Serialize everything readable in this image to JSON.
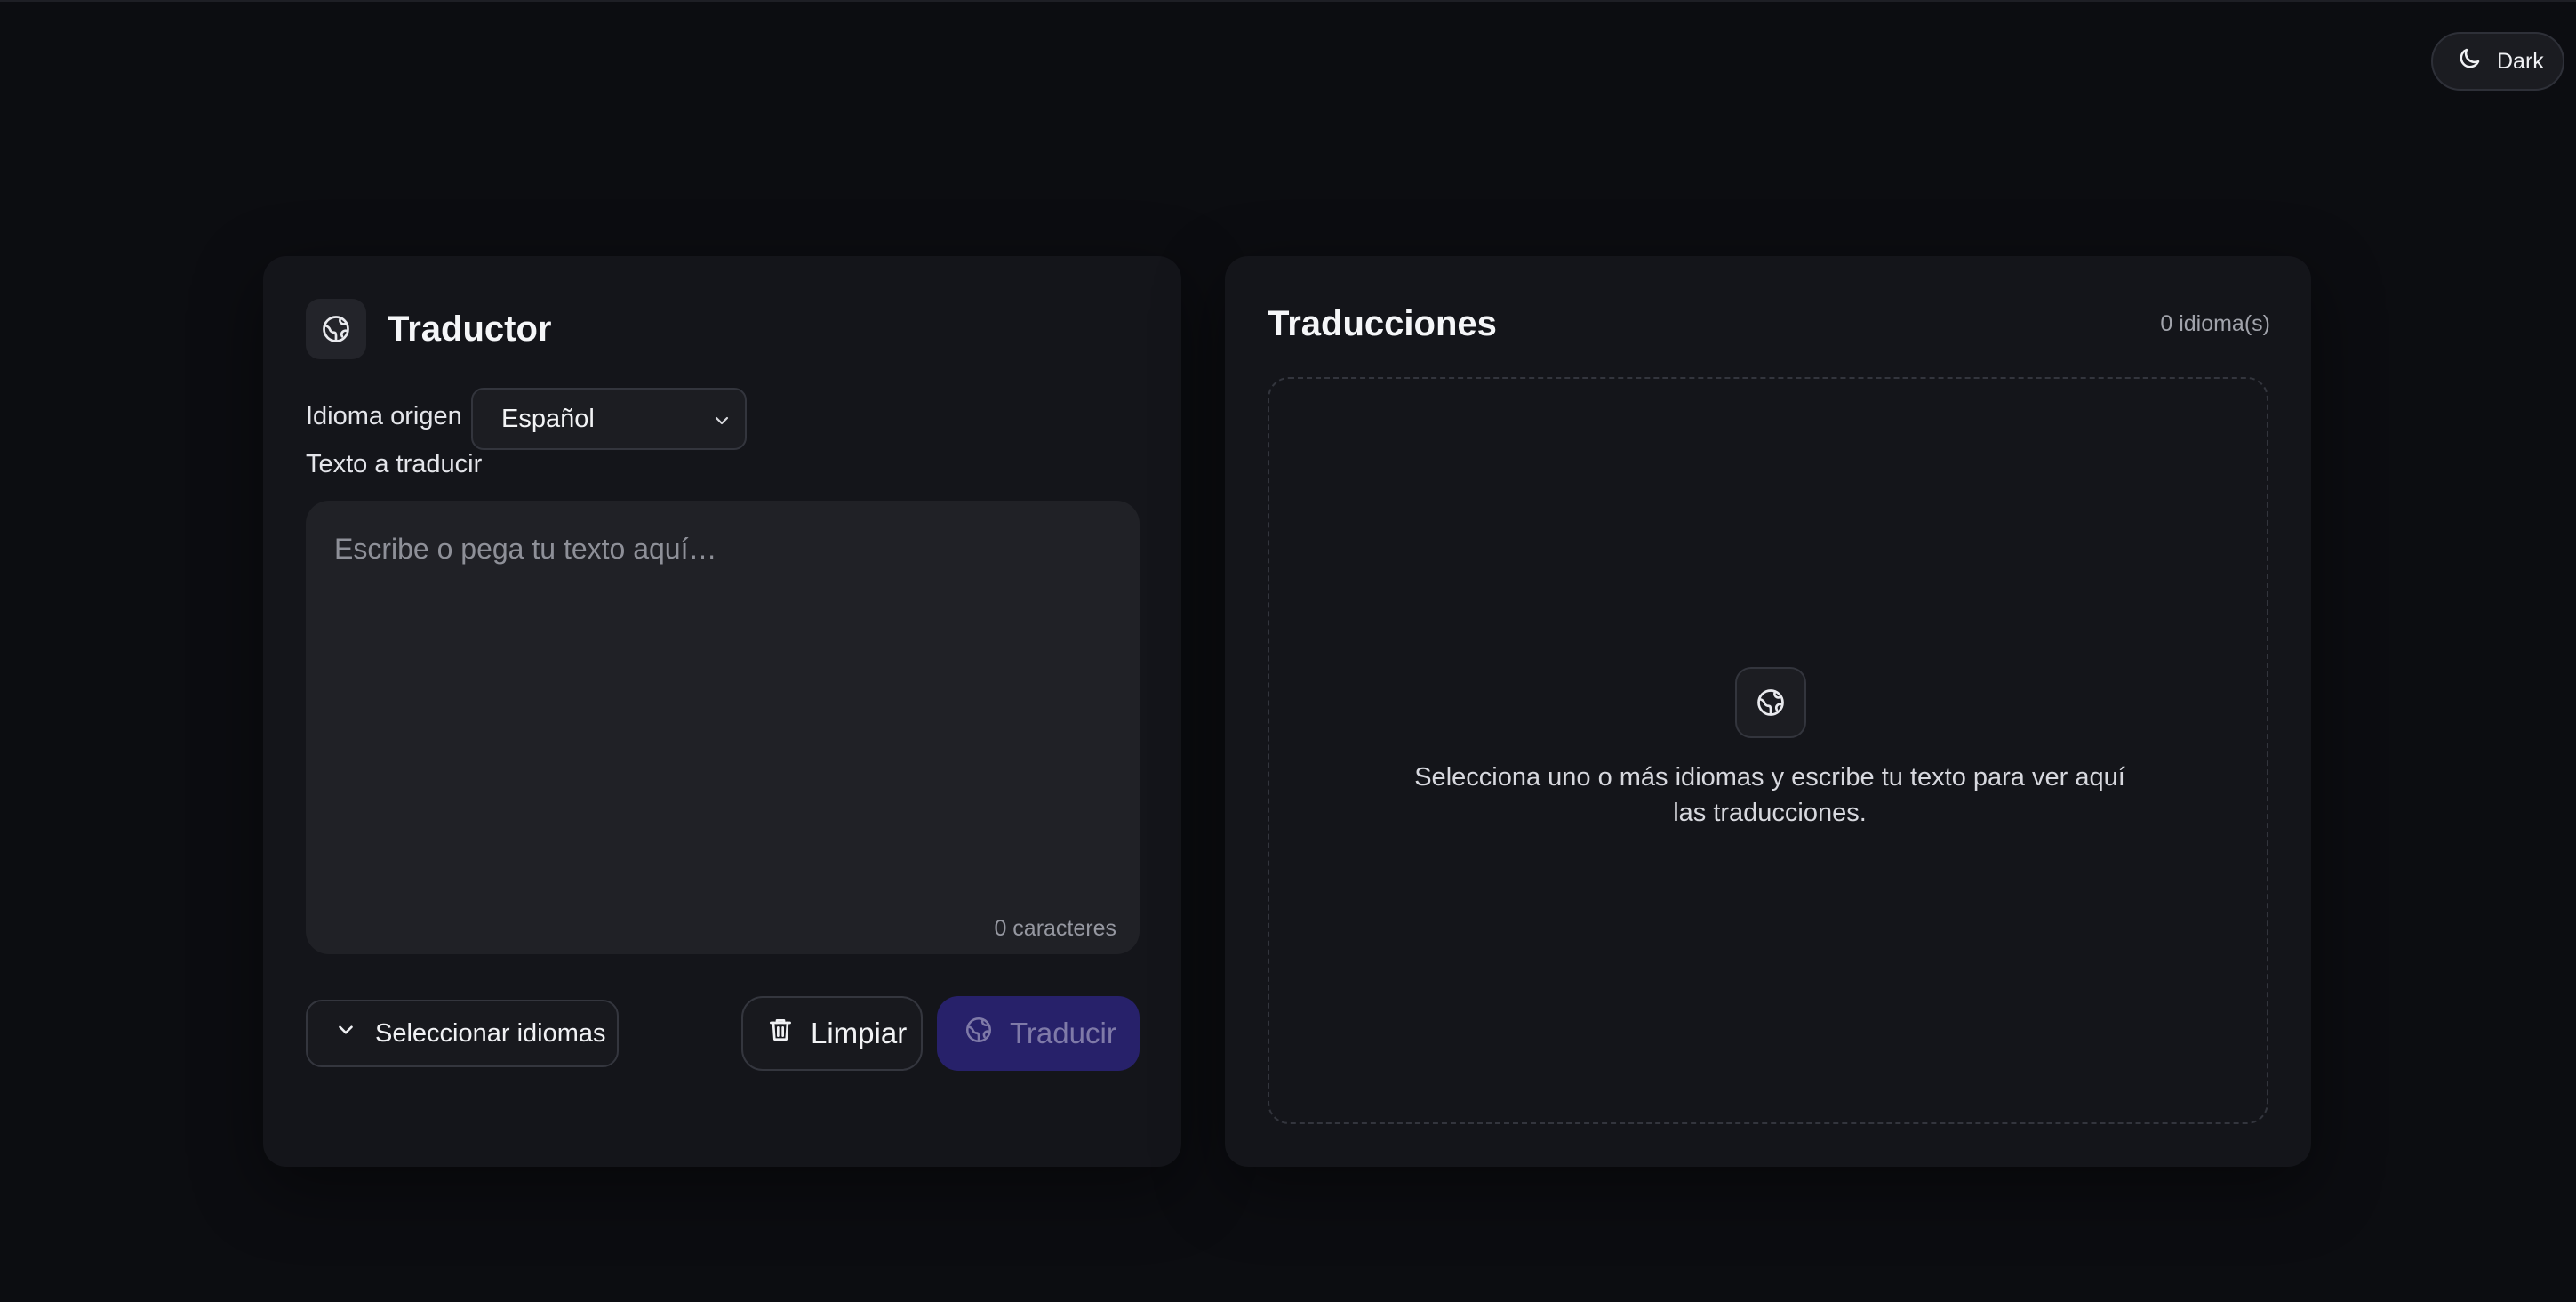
{
  "theme_toggle": {
    "label": "Dark",
    "icon": "moon-icon"
  },
  "translator": {
    "title": "Traductor",
    "icon": "globe-icon",
    "source_label": "Idioma origen",
    "source_value": "Español",
    "text_label": "Texto a traducir",
    "text_placeholder": "Escribe o pega tu texto aquí…",
    "char_count": "0 caracteres",
    "select_languages_label": "Seleccionar idiomas",
    "clear_label": "Limpiar",
    "translate_label": "Traducir"
  },
  "translations": {
    "title": "Traducciones",
    "count": "0 idioma(s)",
    "empty_message": "Selecciona uno o más idiomas y escribe tu texto para ver aquí las traducciones."
  },
  "colors": {
    "background": "#0c0d11",
    "card": "#14151a",
    "accent": "#27216a"
  }
}
